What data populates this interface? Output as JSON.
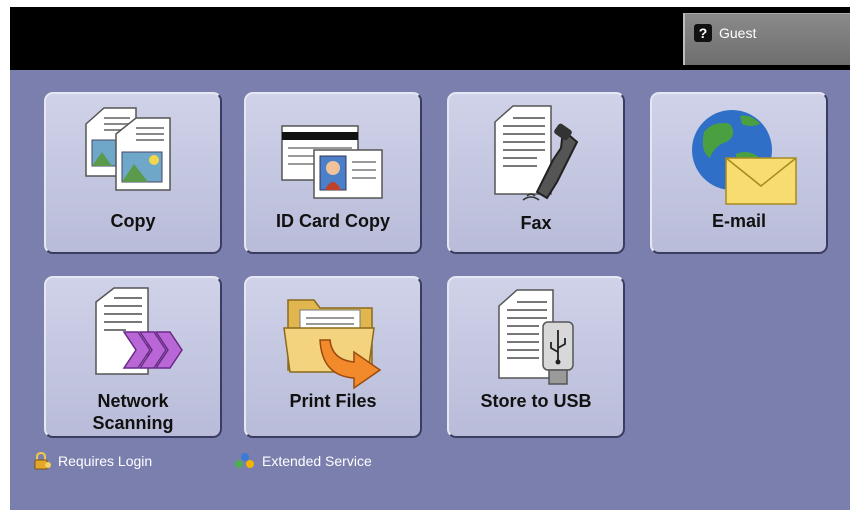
{
  "header": {
    "user_label": "Guest",
    "user_icon": "question-mark-icon"
  },
  "tiles": [
    {
      "label": "Copy",
      "icon": "copy-icon"
    },
    {
      "label": "ID Card Copy",
      "icon": "id-card-icon"
    },
    {
      "label": "Fax",
      "icon": "fax-icon"
    },
    {
      "label": "E-mail",
      "icon": "email-icon"
    },
    {
      "label_line1": "Network",
      "label_line2": "Scanning",
      "icon": "network-scan-icon"
    },
    {
      "label": "Print Files",
      "icon": "print-files-icon"
    },
    {
      "label": "Store to USB",
      "icon": "usb-icon"
    }
  ],
  "legend": {
    "requires_login": "Requires Login",
    "extended_service": "Extended Service"
  },
  "colors": {
    "background": "#7b7fae",
    "tile": "#c4c7e1",
    "top_bar": "#000000",
    "guest_button": "#7a7a7a"
  }
}
